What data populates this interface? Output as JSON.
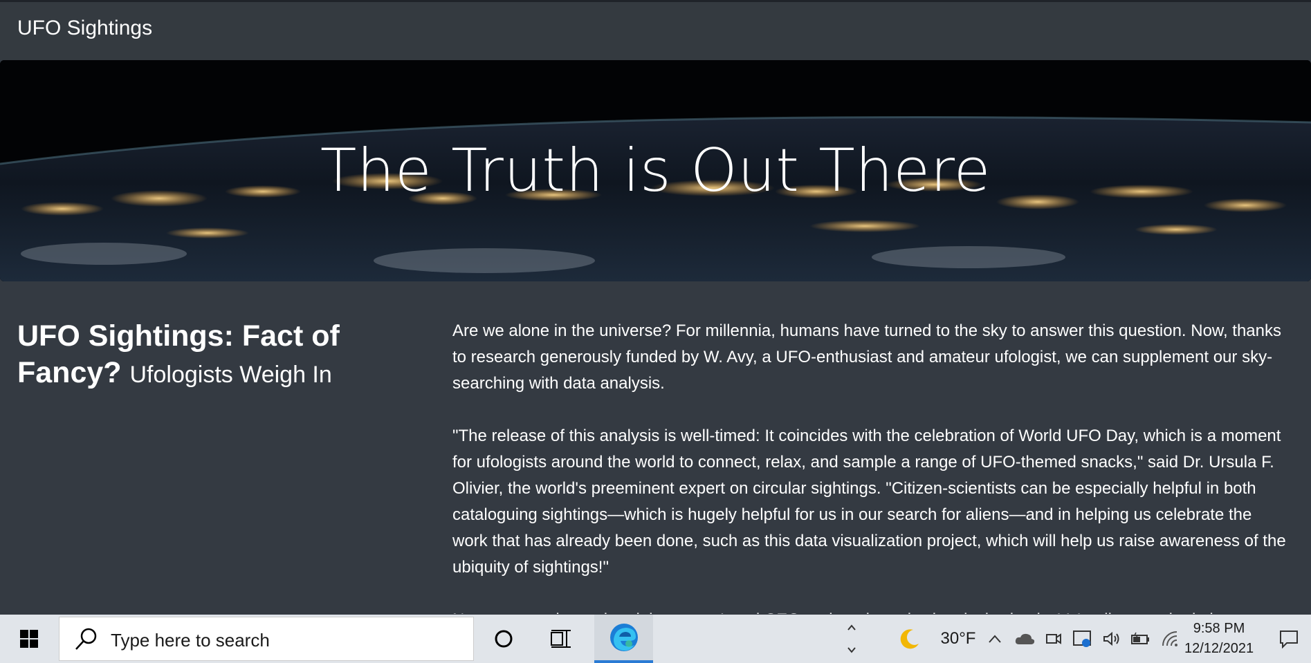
{
  "navbar": {
    "brand": "UFO Sightings"
  },
  "hero": {
    "title": "The Truth is Out There"
  },
  "article": {
    "heading": "UFO Sightings: Fact of Fancy?",
    "subheading": "Ufologists Weigh In",
    "paragraphs": [
      "Are we alone in the universe? For millennia, humans have turned to the sky to answer this question. Now, thanks to research generously funded by W. Avy, a UFO-enthusiast and amateur ufologist, we can supplement our sky-searching with data analysis.",
      "\"The release of this analysis is well-timed: It coincides with the celebration of World UFO Day, which is a moment for ufologists around the world to connect, relax, and sample a range of UFO-themed snacks,\" said Dr. Ursula F. Olivier, the world's preeminent expert on circular sightings. \"Citizen-scientists can be especially helpful in both cataloguing sightings—which is hugely helpful for us in our search for aliens—and in helping us celebrate the work that has already been done, such as this data visualization project, which will help us raise awareness of the ubiquity of sightings!\"",
      "Not everyone is so elated, however. Local CEO and moderately skeptical scientist V. Isedin remarked about t"
    ]
  },
  "taskbar": {
    "search_placeholder": "Type here to search",
    "weather_temp": "30°F",
    "time": "9:58 PM",
    "date": "12/12/2021",
    "icons": [
      "windows-start-icon",
      "search-icon",
      "cortana-icon",
      "task-view-icon",
      "edge-icon",
      "moon-icon",
      "chevron-up-icon",
      "onedrive-cloud-icon",
      "meet-now-icon",
      "notifications-app-icon",
      "volume-icon",
      "battery-icon",
      "wifi-icon",
      "action-center-icon"
    ]
  }
}
